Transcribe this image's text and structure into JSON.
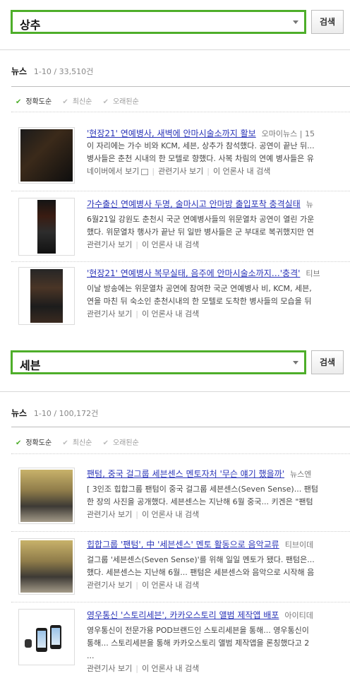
{
  "search_1": {
    "query": "상추",
    "button": "검색"
  },
  "section_1": {
    "title": "뉴스",
    "count": "1-10 / 33,510건",
    "sorts": [
      "정확도순",
      "최신순",
      "오래된순"
    ],
    "items": [
      {
        "title": "'현장21' 연예병사, 새벽에 안마시술소까지 활보",
        "source": "오마이뉴스 | 15",
        "desc1": "이 자리에는 가수 비와 KCM, 세븐, 상추가 참석했다. 공연이 끝난 뒤...",
        "desc2": "병사들은 춘천 시내의 한 모텔로 향했다. 사복 차림의 연예 병사들은 유",
        "link_main": "네이버에서 보기",
        "link_rel": "관련기사 보기",
        "link_press": "이 언론사 내 검색"
      },
      {
        "title": "가수출신 연예병사 두명, 술마시고 안마방 출입포착 충격실태",
        "source": "뉴",
        "desc1": "6월21일 강원도 춘천시 국군 연예병사들의 위문열차 공연이 열린 가운",
        "desc2": "했다. 위문열차 행사가 끝난 뒤 일반 병사들은 군 부대로 복귀했지만 연",
        "link_rel": "관련기사 보기",
        "link_press": "이 언론사 내 검색"
      },
      {
        "title": "'현장21' 연예병사 복무실태, 음주에 안마시술소까지…'충격'",
        "source": "티브",
        "desc1": "이날 방송에는 위문열차 공연에 참여한 국군 연예병사 비, KCM, 세븐,",
        "desc2": "연을 마친 뒤 숙소인 춘천시내의 한 모텔로 도착한 병사들의 모습을 뒤",
        "link_rel": "관련기사 보기",
        "link_press": "이 언론사 내 검색"
      }
    ]
  },
  "search_2": {
    "query": "세븐",
    "button": "검색"
  },
  "section_2": {
    "title": "뉴스",
    "count": "1-10 / 100,172건",
    "sorts": [
      "정확도순",
      "최신순",
      "오래된순"
    ],
    "items": [
      {
        "title": "팬텀, 중국 걸그룹 세븐센스 멘토자처 '무슨 얘기 했을까'",
        "source": "뉴스엔",
        "desc1": "[ 3인조 힙합그룹 팬텀이 중국 걸그룹 세븐센스(Seven Sense)... 팬텀",
        "desc2": "한 장의 사진을 공개했다. 세븐센스는 지난해 6월 중국... 키겐은 \"팬텀",
        "link_rel": "관련기사 보기",
        "link_press": "이 언론사 내 검색"
      },
      {
        "title": "힙합그룹 '팬텀', 中 '세븐센스' 멘토 활동으로 음악교류",
        "source": "티브이데",
        "desc1": "걸그룹 '세븐센스(Seven Sense)'를 위해 일일 멘토가 됐다. 팬텀은...",
        "desc2": "했다. 세븐센스는 지난해 6월... 팬텀은 세븐센스와 음악으로 시작해 음",
        "link_rel": "관련기사 보기",
        "link_press": "이 언론사 내 검색"
      },
      {
        "title": "영우통신 '스토리세븐', 카카오스토리 앨범 제작앱 배포",
        "source": "아이티데",
        "desc1": "영우통신이 전문가용 POD브랜드인 스토리세븐을 통해... 영우통신이",
        "desc2": "통해... 스토리세븐을 통해 카카오스토리 앨범 제작앱을 론칭했다고 2",
        "desc3": "...",
        "link_rel": "관련기사 보기",
        "link_press": "이 언론사 내 검색"
      }
    ]
  }
}
